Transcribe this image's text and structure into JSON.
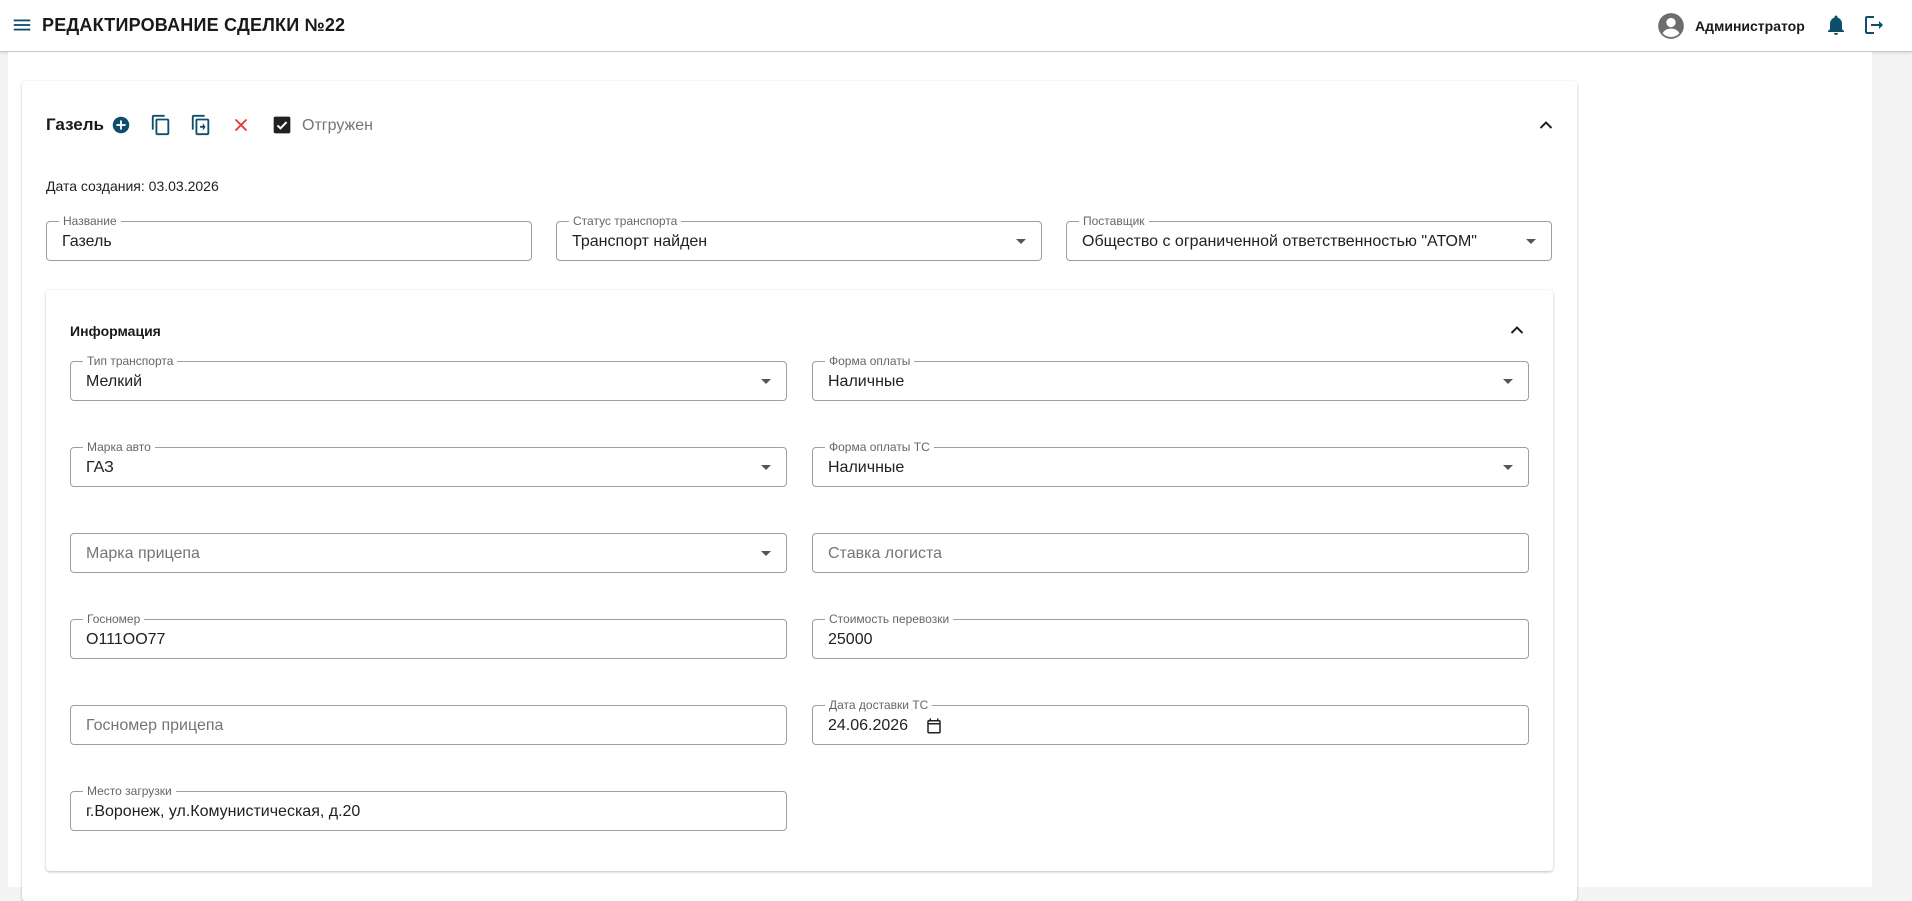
{
  "app_bar": {
    "title": "РЕДАКТИРОВАНИЕ СДЕЛКИ №22",
    "user_name": "Администратор"
  },
  "colors": {
    "brand": "#0d4f6b",
    "delete": "#e53935",
    "checkbox": "#212121"
  },
  "card": {
    "title": "Газель",
    "actions": [
      "plus-circle-icon",
      "copy-icon",
      "duplicate-icon",
      "close-icon"
    ],
    "checkbox_label": "Отгружен",
    "checkbox_checked": true,
    "date_created": "Дата создания: 03.03.2026",
    "fields": {
      "name": {
        "label": "Название",
        "value": "Газель"
      },
      "transport_status": {
        "label": "Статус транспорта",
        "value": "Транспорт найден"
      },
      "supplier": {
        "label": "Поставщик",
        "value": "Общество с ограниченной ответственностью \"АТОМ\""
      }
    }
  },
  "info": {
    "title": "Информация",
    "fields": {
      "transport_type": {
        "label": "Тип транспорта",
        "value": "Мелкий"
      },
      "payment_form": {
        "label": "Форма оплаты",
        "value": "Наличные"
      },
      "car_brand": {
        "label": "Марка авто",
        "value": "ГАЗ"
      },
      "payment_form_ts": {
        "label": "Форма оплаты ТС",
        "value": "Наличные"
      },
      "trailer_brand": {
        "placeholder": "Марка прицепа"
      },
      "logist_rate": {
        "placeholder": "Ставка логиста"
      },
      "plate": {
        "label": "Госномер",
        "value": "О111ОО77"
      },
      "cost": {
        "label": "Стоимость перевозки",
        "value": "25000"
      },
      "trailer_plate": {
        "placeholder": "Госномер прицепа"
      },
      "delivery_date": {
        "label": "Дата доставки ТС",
        "value": "24.06.2026"
      },
      "loading_place": {
        "label": "Место загрузки",
        "value": "г.Воронеж, ул.Комунистическая, д.20"
      }
    }
  }
}
